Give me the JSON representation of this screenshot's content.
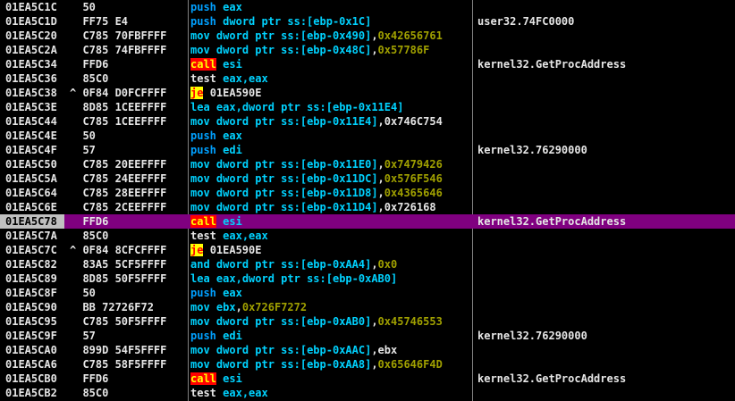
{
  "columns": [
    "address",
    "hex_dump",
    "disassembly",
    "comment"
  ],
  "colors": {
    "background": "#000000",
    "selected_row": "#800080",
    "selected_address_bg": "#c0c0c0",
    "mnemonic_mov": "#00d2ff",
    "mnemonic_push": "#00a0ff",
    "call_bg": "#ff0000",
    "call_fg": "#ffff00",
    "jump_bg": "#ffff00",
    "jump_fg": "#ff0000",
    "immediate": "#a0a000",
    "separator": "#808080"
  },
  "rows": [
    {
      "addr": "01EA5C1C",
      "mark": " ",
      "hex": "50",
      "mn": "push",
      "cls": "t-push",
      "ops": [
        {
          "t": "eax",
          "c": "t-cyan"
        }
      ],
      "comment": ""
    },
    {
      "addr": "01EA5C1D",
      "mark": " ",
      "hex": "FF75 E4",
      "mn": "push",
      "cls": "t-push",
      "ops": [
        {
          "t": "dword ptr ss:[ebp-0x1C]",
          "c": "t-cyan"
        }
      ],
      "comment": "user32.74FC0000"
    },
    {
      "addr": "01EA5C20",
      "mark": " ",
      "hex": "C785 70FBFFFF",
      "mn": "mov",
      "cls": "t-mov",
      "ops": [
        {
          "t": "dword ptr ss:[ebp-0x490]",
          "c": "t-cyan"
        },
        {
          "t": ",",
          "c": "t-plain"
        },
        {
          "t": "0x42656761",
          "c": "t-imm"
        }
      ],
      "comment": ""
    },
    {
      "addr": "01EA5C2A",
      "mark": " ",
      "hex": "C785 74FBFFFF",
      "mn": "mov",
      "cls": "t-mov",
      "ops": [
        {
          "t": "dword ptr ss:[ebp-0x48C]",
          "c": "t-cyan"
        },
        {
          "t": ",",
          "c": "t-plain"
        },
        {
          "t": "0x57786F",
          "c": "t-imm"
        }
      ],
      "comment": ""
    },
    {
      "addr": "01EA5C34",
      "mark": " ",
      "hex": "FFD6",
      "mn": "call",
      "cls": "t-call",
      "ops": [
        {
          "t": "esi",
          "c": "t-cyan"
        }
      ],
      "comment": "kernel32.GetProcAddress"
    },
    {
      "addr": "01EA5C36",
      "mark": " ",
      "hex": "85C0",
      "mn": "test",
      "cls": "t-test",
      "ops": [
        {
          "t": "eax,eax",
          "c": "t-cyan"
        }
      ],
      "comment": ""
    },
    {
      "addr": "01EA5C38",
      "mark": "^",
      "hex": "0F84 D0FCFFFF",
      "mn": "je",
      "cls": "t-je",
      "ops": [
        {
          "t": "01EA590E",
          "c": "t-plain"
        }
      ],
      "comment": ""
    },
    {
      "addr": "01EA5C3E",
      "mark": " ",
      "hex": "8D85 1CEEFFFF",
      "mn": "lea",
      "cls": "t-lea",
      "ops": [
        {
          "t": "eax,dword ptr ss:[ebp-0x11E4]",
          "c": "t-cyan"
        }
      ],
      "comment": ""
    },
    {
      "addr": "01EA5C44",
      "mark": " ",
      "hex": "C785 1CEEFFFF",
      "mn": "mov",
      "cls": "t-mov",
      "ops": [
        {
          "t": "dword ptr ss:[ebp-0x11E4]",
          "c": "t-cyan"
        },
        {
          "t": ",0x746C754",
          "c": "t-plain"
        }
      ],
      "comment": ""
    },
    {
      "addr": "01EA5C4E",
      "mark": " ",
      "hex": "50",
      "mn": "push",
      "cls": "t-push",
      "ops": [
        {
          "t": "eax",
          "c": "t-cyan"
        }
      ],
      "comment": ""
    },
    {
      "addr": "01EA5C4F",
      "mark": " ",
      "hex": "57",
      "mn": "push",
      "cls": "t-push",
      "ops": [
        {
          "t": "edi",
          "c": "t-cyan"
        }
      ],
      "comment": "kernel32.76290000"
    },
    {
      "addr": "01EA5C50",
      "mark": " ",
      "hex": "C785 20EEFFFF",
      "mn": "mov",
      "cls": "t-mov",
      "ops": [
        {
          "t": "dword ptr ss:[ebp-0x11E0]",
          "c": "t-cyan"
        },
        {
          "t": ",",
          "c": "t-plain"
        },
        {
          "t": "0x7479426",
          "c": "t-imm"
        }
      ],
      "comment": ""
    },
    {
      "addr": "01EA5C5A",
      "mark": " ",
      "hex": "C785 24EEFFFF",
      "mn": "mov",
      "cls": "t-mov",
      "ops": [
        {
          "t": "dword ptr ss:[ebp-0x11DC]",
          "c": "t-cyan"
        },
        {
          "t": ",",
          "c": "t-plain"
        },
        {
          "t": "0x576F546",
          "c": "t-imm"
        }
      ],
      "comment": ""
    },
    {
      "addr": "01EA5C64",
      "mark": " ",
      "hex": "C785 28EEFFFF",
      "mn": "mov",
      "cls": "t-mov",
      "ops": [
        {
          "t": "dword ptr ss:[ebp-0x11D8]",
          "c": "t-cyan"
        },
        {
          "t": ",",
          "c": "t-plain"
        },
        {
          "t": "0x4365646",
          "c": "t-imm"
        }
      ],
      "comment": ""
    },
    {
      "addr": "01EA5C6E",
      "mark": " ",
      "hex": "C785 2CEEFFFF",
      "mn": "mov",
      "cls": "t-mov",
      "ops": [
        {
          "t": "dword ptr ss:[ebp-0x11D4]",
          "c": "t-cyan"
        },
        {
          "t": ",0x726168",
          "c": "t-plain"
        }
      ],
      "comment": ""
    },
    {
      "addr": "01EA5C78",
      "mark": " ",
      "hex": "FFD6",
      "mn": "call",
      "cls": "t-call",
      "ops": [
        {
          "t": "esi",
          "c": "t-cyan"
        }
      ],
      "comment": "kernel32.GetProcAddress",
      "selected": true
    },
    {
      "addr": "01EA5C7A",
      "mark": " ",
      "hex": "85C0",
      "mn": "test",
      "cls": "t-test",
      "ops": [
        {
          "t": "eax,eax",
          "c": "t-cyan"
        }
      ],
      "comment": ""
    },
    {
      "addr": "01EA5C7C",
      "mark": "^",
      "hex": "0F84 8CFCFFFF",
      "mn": "je",
      "cls": "t-je",
      "ops": [
        {
          "t": "01EA590E",
          "c": "t-plain"
        }
      ],
      "comment": ""
    },
    {
      "addr": "01EA5C82",
      "mark": " ",
      "hex": "83A5 5CF5FFFF",
      "mn": "and",
      "cls": "t-and",
      "ops": [
        {
          "t": "dword ptr ss:[ebp-0xAA4]",
          "c": "t-cyan"
        },
        {
          "t": ",",
          "c": "t-plain"
        },
        {
          "t": "0x0",
          "c": "t-imm"
        }
      ],
      "comment": ""
    },
    {
      "addr": "01EA5C89",
      "mark": " ",
      "hex": "8D85 50F5FFFF",
      "mn": "lea",
      "cls": "t-lea",
      "ops": [
        {
          "t": "eax,dword ptr ss:[ebp-0xAB0]",
          "c": "t-cyan"
        }
      ],
      "comment": ""
    },
    {
      "addr": "01EA5C8F",
      "mark": " ",
      "hex": "50",
      "mn": "push",
      "cls": "t-push",
      "ops": [
        {
          "t": "eax",
          "c": "t-cyan"
        }
      ],
      "comment": ""
    },
    {
      "addr": "01EA5C90",
      "mark": " ",
      "hex": "BB 72726F72",
      "mn": "mov",
      "cls": "t-mov",
      "ops": [
        {
          "t": "ebx",
          "c": "t-cyan"
        },
        {
          "t": ",",
          "c": "t-plain"
        },
        {
          "t": "0x726F7272",
          "c": "t-imm"
        }
      ],
      "comment": ""
    },
    {
      "addr": "01EA5C95",
      "mark": " ",
      "hex": "C785 50F5FFFF",
      "mn": "mov",
      "cls": "t-mov",
      "ops": [
        {
          "t": "dword ptr ss:[ebp-0xAB0]",
          "c": "t-cyan"
        },
        {
          "t": ",",
          "c": "t-plain"
        },
        {
          "t": "0x45746553",
          "c": "t-imm"
        }
      ],
      "comment": ""
    },
    {
      "addr": "01EA5C9F",
      "mark": " ",
      "hex": "57",
      "mn": "push",
      "cls": "t-push",
      "ops": [
        {
          "t": "edi",
          "c": "t-cyan"
        }
      ],
      "comment": "kernel32.76290000"
    },
    {
      "addr": "01EA5CA0",
      "mark": " ",
      "hex": "899D 54F5FFFF",
      "mn": "mov",
      "cls": "t-mov",
      "ops": [
        {
          "t": "dword ptr ss:[ebp-0xAAC]",
          "c": "t-cyan"
        },
        {
          "t": ",ebx",
          "c": "t-plain"
        }
      ],
      "comment": ""
    },
    {
      "addr": "01EA5CA6",
      "mark": " ",
      "hex": "C785 58F5FFFF",
      "mn": "mov",
      "cls": "t-mov",
      "ops": [
        {
          "t": "dword ptr ss:[ebp-0xAA8]",
          "c": "t-cyan"
        },
        {
          "t": ",",
          "c": "t-plain"
        },
        {
          "t": "0x65646F4D",
          "c": "t-imm"
        }
      ],
      "comment": ""
    },
    {
      "addr": "01EA5CB0",
      "mark": " ",
      "hex": "FFD6",
      "mn": "call",
      "cls": "t-call",
      "ops": [
        {
          "t": "esi",
          "c": "t-cyan"
        }
      ],
      "comment": "kernel32.GetProcAddress"
    },
    {
      "addr": "01EA5CB2",
      "mark": " ",
      "hex": "85C0",
      "mn": "test",
      "cls": "t-test",
      "ops": [
        {
          "t": "eax,eax",
          "c": "t-cyan"
        }
      ],
      "comment": ""
    }
  ]
}
